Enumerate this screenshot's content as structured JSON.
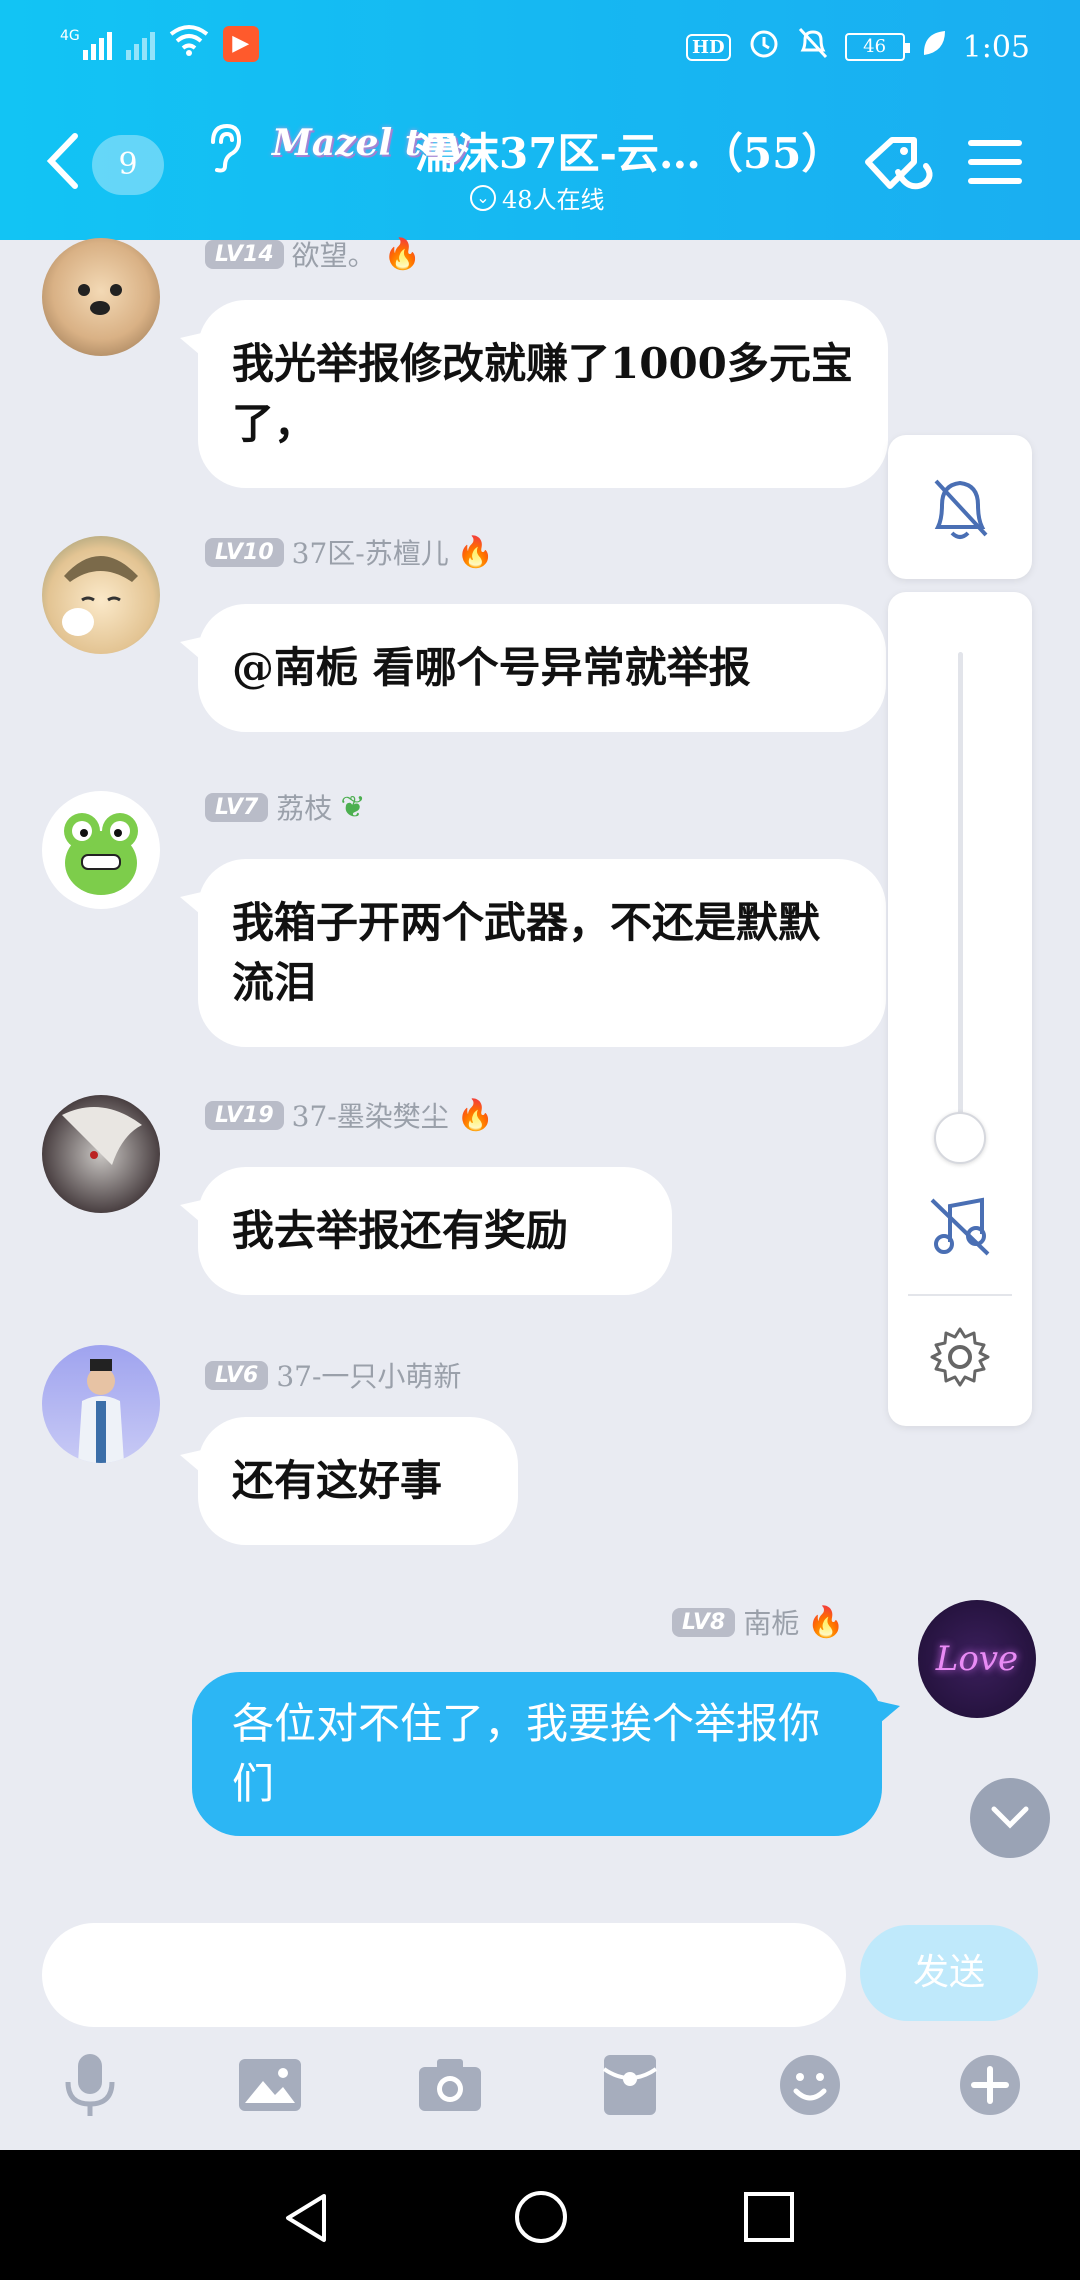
{
  "status": {
    "network": "4G",
    "hd": "HD",
    "battery": "46",
    "time": "1:05"
  },
  "header": {
    "back_count": "9",
    "badge_text": "Mazel toy",
    "title": "濡沫37区-云…（55）",
    "online": "48人在线"
  },
  "messages": [
    {
      "level": "LV14",
      "name": "欲望。",
      "text": "我光举报修改就赚了1000多元宝了，"
    },
    {
      "level": "LV10",
      "name": "37区-苏檀儿",
      "text": "@南栀 看哪个号异常就举报"
    },
    {
      "level": "LV7",
      "name": "荔枝",
      "text": "我箱子开两个武器，不还是默默流泪"
    },
    {
      "level": "LV19",
      "name": "37-墨染樊尘",
      "text": "我去举报还有奖励"
    },
    {
      "level": "LV6",
      "name": "37-一只小萌新",
      "text": "还有这好事"
    },
    {
      "level": "LV8",
      "name": "南栀",
      "text": "各位对不住了，我要挨个举报你们",
      "mine": true
    }
  ],
  "self_avatar_text": "Love",
  "volume_level": 0.0,
  "input": {
    "placeholder": "",
    "send_label": "发送"
  },
  "colors": {
    "header": "#16b8f2",
    "my_bubble": "#2cb6f4",
    "send_disabled": "#bfe9fb",
    "background": "#e9ebf2"
  }
}
